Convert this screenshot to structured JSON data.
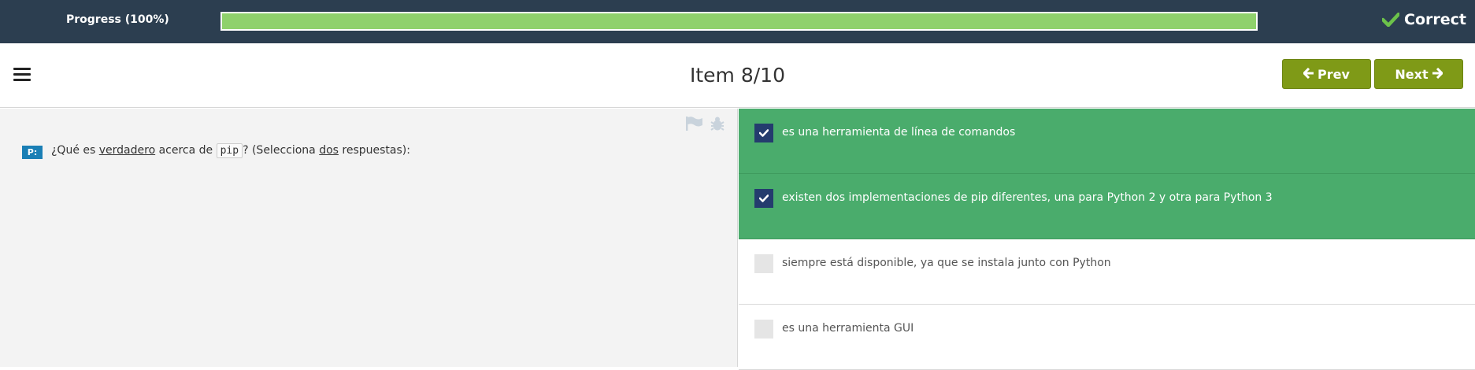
{
  "progress": {
    "label": "Progress (100%)",
    "percent": 100,
    "status": "Correct",
    "status_icon": "check-icon"
  },
  "header": {
    "title": "Item 8/10",
    "menu_icon": "hamburger-menu-icon",
    "prev_label": "Prev",
    "next_label": "Next"
  },
  "question": {
    "badge": "P:",
    "text_before": "¿Qué es ",
    "emph1": "verdadero",
    "text_mid": " acerca de ",
    "code": "pip",
    "text_after": "? (Selecciona ",
    "emph2": "dos",
    "text_end": " respuestas):",
    "tools": [
      "flag-icon",
      "bug-icon"
    ]
  },
  "answers": [
    {
      "text": "es una herramienta de línea de comandos",
      "selected": true
    },
    {
      "text": "existen dos implementaciones de pip diferentes, una para Python 2 y otra para Python 3",
      "selected": true
    },
    {
      "text": "siempre está disponible, ya que se instala junto con Python",
      "selected": false
    },
    {
      "text": "es una herramienta GUI",
      "selected": false
    }
  ],
  "colors": {
    "topbar": "#2c3e50",
    "progress_fill": "#8fd16c",
    "nav_button": "#7f9a17",
    "selected_answer": "#4aac6c",
    "checkbox_checked": "#243c6e",
    "status_check": "#6cc24a"
  }
}
